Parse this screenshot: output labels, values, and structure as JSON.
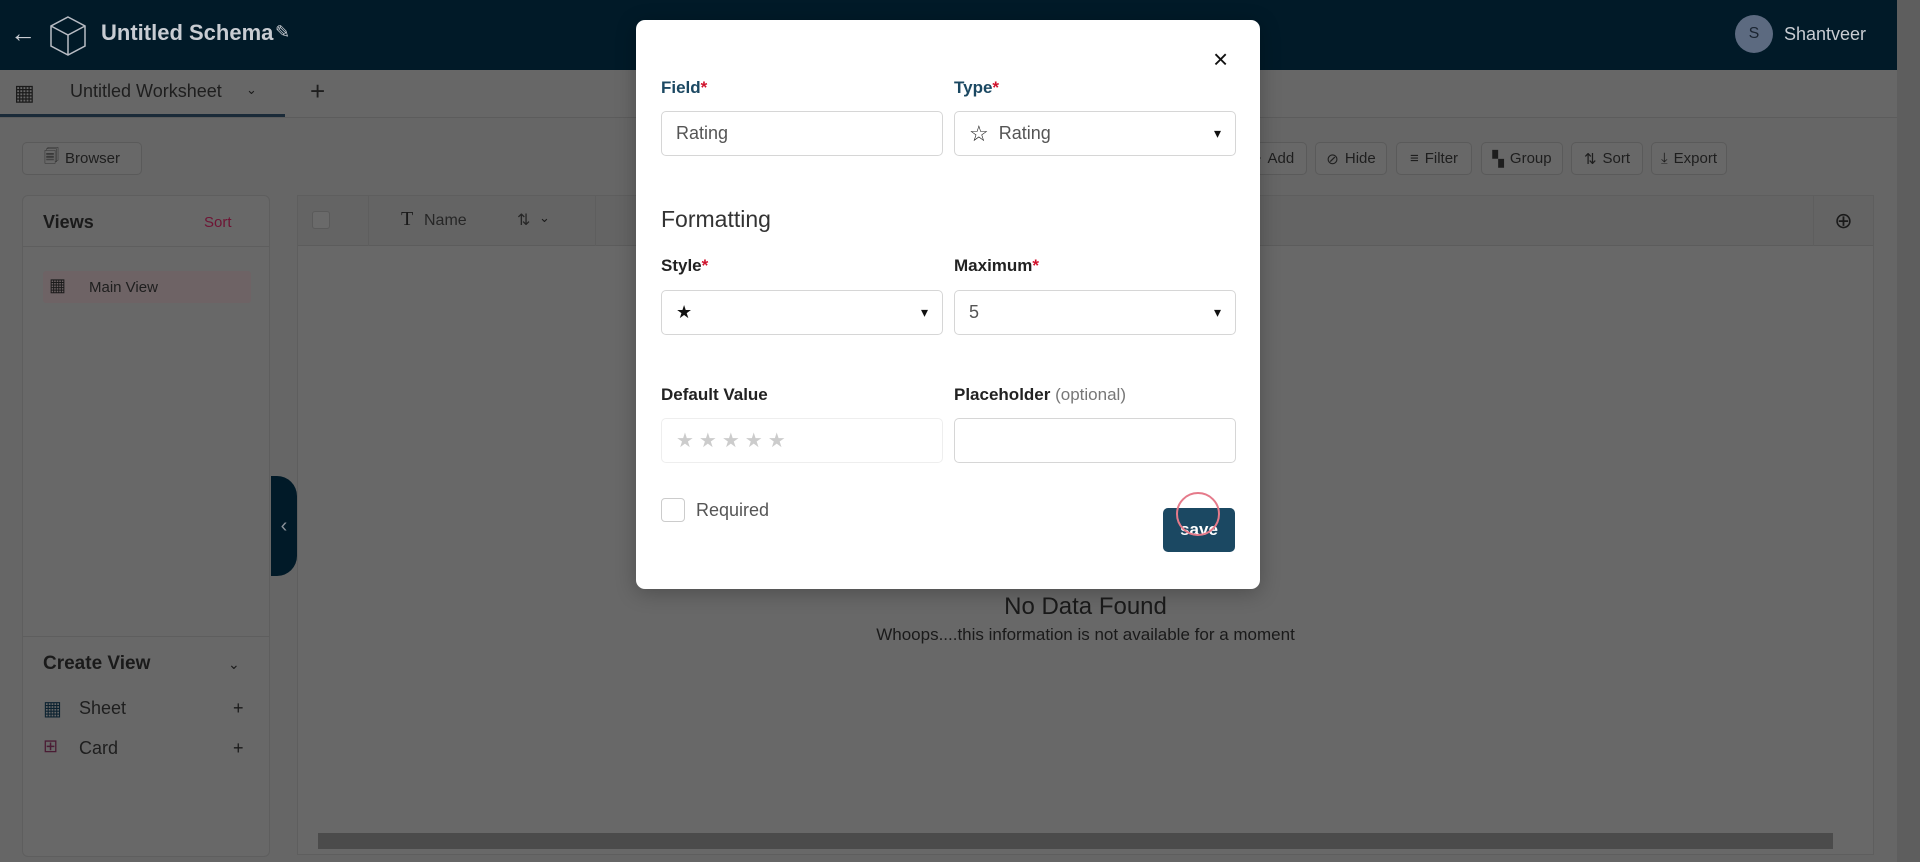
{
  "header": {
    "title": "Untitled Schema",
    "user_initial": "S",
    "user_name": "Shantveer"
  },
  "tabs": {
    "worksheet": "Untitled Worksheet"
  },
  "toolbar": {
    "browser": "Browser",
    "add": "Add",
    "hide": "Hide",
    "filter": "Filter",
    "group": "Group",
    "sort": "Sort",
    "export": "Export"
  },
  "views": {
    "title": "Views",
    "sort": "Sort",
    "items": [
      {
        "label": "Main View"
      }
    ],
    "create_title": "Create View",
    "create_items": [
      {
        "label": "Sheet"
      },
      {
        "label": "Card"
      }
    ]
  },
  "grid": {
    "column": "Name",
    "empty_title": "No Data Found",
    "empty_text": "Whoops....this information is not available for a moment"
  },
  "modal": {
    "field_label": "Field",
    "field_value": "Rating",
    "type_label": "Type",
    "type_value": "Rating",
    "section": "Formatting",
    "style_label": "Style",
    "style_value": "★",
    "maximum_label": "Maximum",
    "maximum_value": "5",
    "default_label": "Default Value",
    "default_stars": "★★★★★",
    "placeholder_label": "Placeholder",
    "placeholder_hint": "(optional)",
    "placeholder_value": "",
    "required_label": "Required",
    "save": "save",
    "close": "×"
  },
  "colors": {
    "header": "#06405f",
    "accent": "#1b4862",
    "required": "#d0112b"
  }
}
